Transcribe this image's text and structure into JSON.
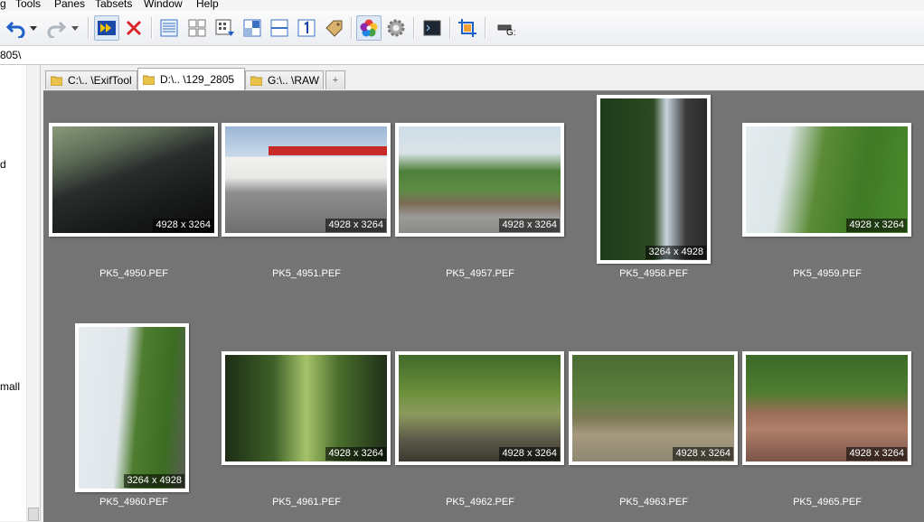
{
  "menu": [
    "g",
    "Tools",
    "Panes",
    "Tabsets",
    "Window",
    "Help"
  ],
  "toolbar": {
    "buttons": [
      {
        "name": "undo-icon"
      },
      {
        "name": "undo-dropdown-icon"
      },
      {
        "name": "redo-icon"
      },
      {
        "name": "redo-dropdown-icon"
      },
      {
        "name": "slideshow-icon"
      },
      {
        "name": "delete-icon"
      },
      {
        "name": "details-view-icon"
      },
      {
        "name": "tiles-view-icon"
      },
      {
        "name": "thumbnails-view-icon"
      },
      {
        "name": "split-view-icon"
      },
      {
        "name": "horizontal-split-icon"
      },
      {
        "name": "single-pane-icon"
      },
      {
        "name": "tag-icon"
      },
      {
        "name": "color-wheel-icon"
      },
      {
        "name": "settings-gear-icon"
      },
      {
        "name": "console-icon"
      },
      {
        "name": "crop-icon"
      },
      {
        "name": "drive-icon"
      }
    ],
    "drive_label": "G:"
  },
  "address": {
    "path": "805\\"
  },
  "leftpane": {
    "items": [
      "d",
      "mall"
    ]
  },
  "tabs": [
    {
      "label": "C:\\.. \\ExifTool",
      "active": false
    },
    {
      "label": "D:\\.. \\129_2805",
      "active": true
    },
    {
      "label": "G:\\.. \\RAW",
      "active": false
    },
    {
      "label": "+",
      "active": false
    }
  ],
  "thumbnails": [
    {
      "name": "PK5_4950.PEF",
      "dims": "4928 x 3264"
    },
    {
      "name": "PK5_4951.PEF",
      "dims": "4928 x 3264"
    },
    {
      "name": "PK5_4957.PEF",
      "dims": "4928 x 3264"
    },
    {
      "name": "PK5_4958.PEF",
      "dims": "3264 x 4928"
    },
    {
      "name": "PK5_4959.PEF",
      "dims": "4928 x 3264"
    },
    {
      "name": "PK5_4960.PEF",
      "dims": "3264 x 4928"
    },
    {
      "name": "PK5_4961.PEF",
      "dims": "4928 x 3264"
    },
    {
      "name": "PK5_4962.PEF",
      "dims": "4928 x 3264"
    },
    {
      "name": "PK5_4963.PEF",
      "dims": "4928 x 3264"
    },
    {
      "name": "PK5_4965.PEF",
      "dims": "4928 x 3264"
    }
  ],
  "colors": {
    "content_bg": "#747474",
    "accent": "#1e62c8",
    "folder": "#e8c24a"
  }
}
